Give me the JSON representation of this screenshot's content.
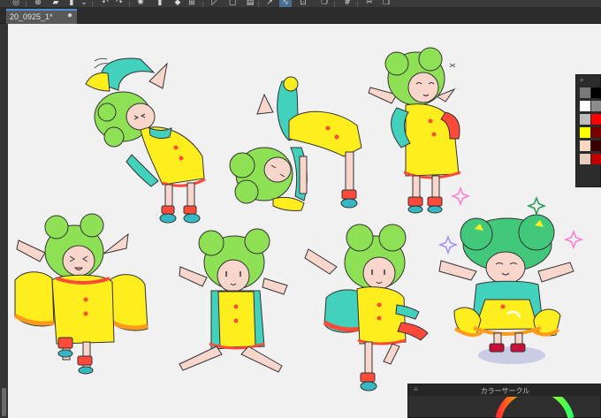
{
  "toolbar": {
    "icons": [
      "app-menu-icon",
      "new-layer-icon",
      "open-folder-icon",
      "save-icon",
      "undo-icon",
      "redo-icon",
      "loading-icon",
      "fill-icon",
      "transform-icon",
      "selection-icon",
      "pen-icon",
      "stabilizer-icon",
      "snap-icon",
      "speech-icon",
      "grid-icon",
      "cut-icon",
      "copy-icon"
    ]
  },
  "tabs": [
    {
      "label": "20_0925_1*",
      "close": "●"
    }
  ],
  "palette": {
    "grip": "≡",
    "swatches": [
      "#7a7a7a",
      "#000000",
      "#ffffff",
      "#8c8c8c",
      "#bdbdbd",
      "#ff0000",
      "#ffff00",
      "#7a0000",
      "#f6d9c3",
      "#3a0000",
      "#e8d0c0",
      "#c10000"
    ]
  },
  "color_panel": {
    "grip": "≡",
    "title": "カラーサークル"
  },
  "colors": {
    "skin": "#f8d6cc",
    "hair": "#8ee055",
    "hair_dark": "#5bb335",
    "dress": "#ffee1e",
    "sleeve": "#41d1bd",
    "trim": "#ff4a3a",
    "shoe": "#35b8c4",
    "sparkle_pink": "#f77fd1",
    "sparkle_purple": "#a68cf2"
  }
}
